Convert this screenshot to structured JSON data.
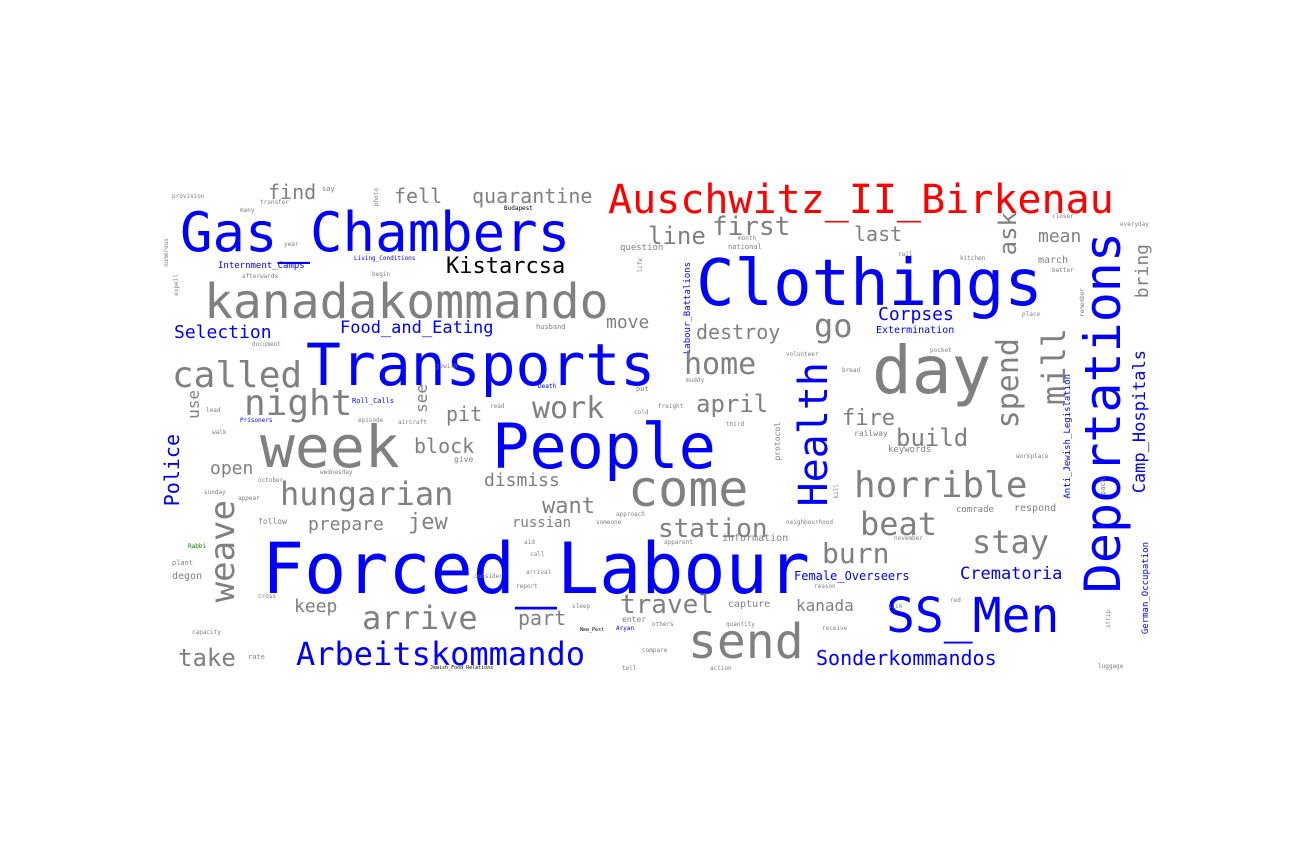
{
  "colors": {
    "concept": "#0000ff",
    "place": "#ff0000",
    "term": "#808080",
    "black": "#000000",
    "green": "#008000"
  },
  "words": {
    "auschwitz": "Auschwitz_II_Birkenau",
    "gas_chambers": "Gas_Chambers",
    "clothings": "Clothings",
    "kanadakommando": "kanadakommando",
    "transports": "Transports",
    "people": "People",
    "week": "week",
    "forced_labour": "Forced_Labour",
    "deportations": "Deportations",
    "ss_men": "SS_Men",
    "day": "day",
    "come": "come",
    "send": "send",
    "health": "Health",
    "kistarcsa": "Kistarcsa",
    "arbeitskommando": "Arbeitskommando",
    "sonderkommandos": "Sonderkommandos",
    "crematoria": "Crematoria",
    "camp_hospitals": "Camp_Hospitals",
    "police": "Police",
    "selection": "Selection",
    "food_and_eating": "Food_and_Eating",
    "corpses": "Corpses",
    "female_overseers": "Female_Overseers",
    "extermination": "Extermination",
    "internment_camps": "Internment_Camps",
    "german_occupation": "German_Occupation",
    "anti_jewish": "Anti_Jewish_Legislation",
    "labour_battalions": "Labour_Battalions",
    "living_conditions": "Living_Conditions",
    "roll_calls": "Roll_Calls",
    "prisoners": "Prisoners",
    "aryan": "Aryan",
    "budapest": "Budapest",
    "death": "Death",
    "new_pest": "New_Pest",
    "jewish_food": "Jewish_Food_Relations",
    "rabbi": "Rabbi",
    "called": "called",
    "night": "night",
    "hungarian": "hungarian",
    "work": "work",
    "home": "home",
    "april": "april",
    "horrible": "horrible",
    "beat": "beat",
    "stay": "stay",
    "burn": "burn",
    "station": "station",
    "want": "want",
    "weave": "weave",
    "arrive": "arrive",
    "travel": "travel",
    "take": "take",
    "keep": "keep",
    "part": "part",
    "kanada": "kanada",
    "go": "go",
    "mill": "mill",
    "spend": "spend",
    "ask": "ask",
    "bring": "bring",
    "build": "build",
    "fire": "fire",
    "first": "first",
    "line": "line",
    "last": "last",
    "mean": "mean",
    "quarantine": "quarantine",
    "fell": "fell",
    "find": "find",
    "move": "move",
    "destroy": "destroy",
    "pit": "pit",
    "block": "block",
    "open": "open",
    "dismiss": "dismiss",
    "jew": "jew",
    "prepare": "prepare",
    "russian": "russian",
    "use": "use",
    "see": "see",
    "respond": "respond",
    "comrade": "comrade",
    "capture": "capture",
    "information": "information",
    "march": "march",
    "say": "say",
    "provision": "provision",
    "follow": "follow",
    "question": "question",
    "national": "national",
    "husband": "husband",
    "episode": "episode",
    "aircraft": "aircraft",
    "protocol": "protocol",
    "railway": "railway",
    "keywords": "keywords",
    "wednesday": "wednesday",
    "sunday": "sunday",
    "degon": "degon",
    "plant": "plant",
    "capacity": "capacity",
    "arrival": "arrival",
    "sleep": "sleep",
    "enter": "enter",
    "others": "others",
    "compare": "compare",
    "quantity": "quantity",
    "receive": "receive",
    "action": "action",
    "luggage": "luggage",
    "afterwards": "afterwards",
    "begin": "begin",
    "document": "document",
    "volunteer": "volunteer",
    "neighbourhood": "neighbourhood",
    "workplace": "workplace",
    "november": "november",
    "everyday": "everyday",
    "closer": "closer",
    "better": "better",
    "place": "place",
    "pocket": "pocket",
    "kitchen": "kitchen",
    "rail": "rail",
    "remember": "remember",
    "strip": "strip",
    "pack": "pack",
    "approach": "approach",
    "apparent": "apparent",
    "cold": "cold",
    "freight": "freight",
    "read": "read",
    "give": "give",
    "write": "write",
    "lead": "lead",
    "happen": "happen",
    "month": "month",
    "third": "third",
    "bread": "bread",
    "kill": "kill",
    "thing": "thing",
    "muddy": "muddy",
    "report": "report",
    "call": "call",
    "aid": "aid",
    "consider": "consider",
    "someone": "someone",
    "tell": "tell",
    "lose": "lose",
    "visit": "visit",
    "jewish": "jewish",
    "friend": "friend",
    "transfer": "transfer",
    "many": "many",
    "photo": "photo",
    "year": "year",
    "walk": "walk",
    "october": "october",
    "appear": "appear",
    "october2": "follow",
    "sick": "sick",
    "red": "red",
    "mind": "mind",
    "save": "save",
    "reason": "reason",
    "cross": "cross",
    "grab": "grab",
    "put": "put",
    "life": "life",
    "numerous": "numerous",
    "expell": "expell",
    "fall": "fall",
    "rate": "rate"
  }
}
